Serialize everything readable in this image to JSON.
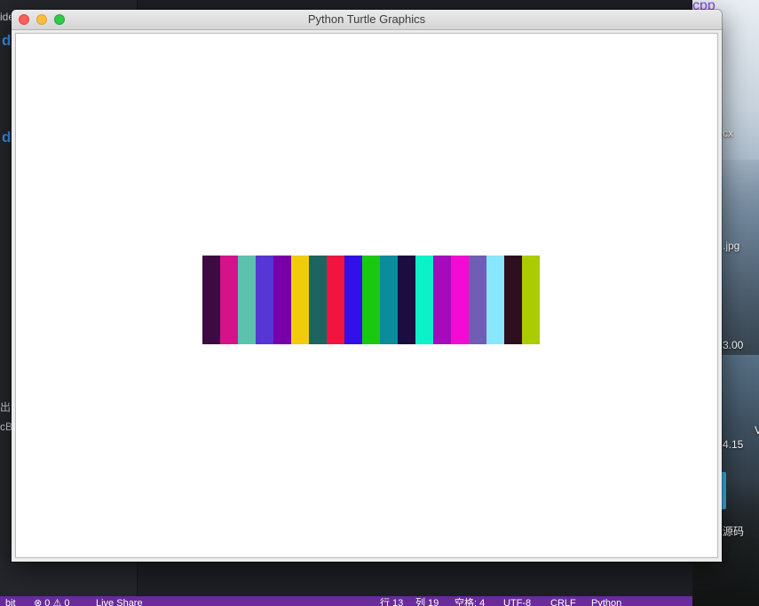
{
  "window": {
    "title": "Python Turtle Graphics"
  },
  "turtle_canvas": {
    "stripe_colors": [
      "#3d0a43",
      "#d6128a",
      "#5cc2ad",
      "#5636d4",
      "#7700a8",
      "#f2cc0c",
      "#1b6460",
      "#f0143e",
      "#3210ea",
      "#1bc810",
      "#0a8c9c",
      "#1a0d40",
      "#0cf2c8",
      "#a60aba",
      "#f40ad2",
      "#6f5db6",
      "#88e6fd",
      "#2e0f1f",
      "#aacc00"
    ]
  },
  "background_editor": {
    "sidebar_fragments": [
      "ide",
      "d",
      "d",
      "出",
      "cB"
    ],
    "statusbar": {
      "left": "bit",
      "problems": "⊗ 0 ⚠ 0",
      "live_share": "Live Share",
      "line": "行 13",
      "column": "列 19",
      "spaces": "空格: 4",
      "encoding": "UTF-8",
      "eol": "CRLF",
      "language": "Python"
    }
  },
  "desktop": {
    "labels": [
      "cpp",
      "cx",
      ".jpg",
      "3.00",
      "4.15",
      "V",
      "源码"
    ]
  }
}
